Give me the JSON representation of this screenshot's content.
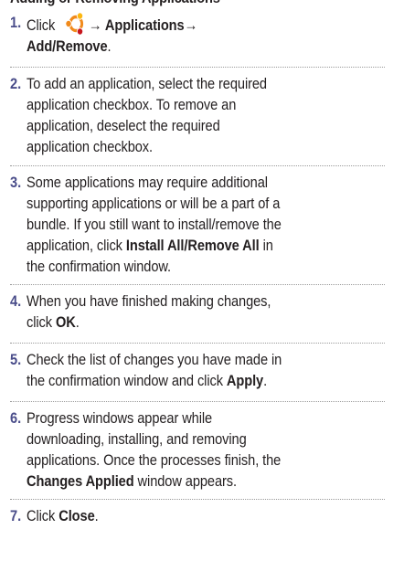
{
  "heading": "Adding or Removing Applications",
  "steps": [
    {
      "number": "1.",
      "segments": [
        {
          "text": "Click ",
          "bold": false
        },
        {
          "icon": "ubuntu-logo-icon"
        },
        {
          "text": "→ Applications→",
          "bold": true
        },
        {
          "br": true
        },
        {
          "text": "Add/Remove",
          "bold": true
        },
        {
          "text": ".",
          "bold": false
        }
      ]
    },
    {
      "number": "2.",
      "segments": [
        {
          "text": "To add an application, select the required",
          "bold": false
        },
        {
          "br": true
        },
        {
          "text": "application checkbox. To remove an",
          "bold": false
        },
        {
          "br": true
        },
        {
          "text": "application, deselect the required",
          "bold": false
        },
        {
          "br": true
        },
        {
          "text": "application checkbox.",
          "bold": false
        }
      ]
    },
    {
      "number": "3.",
      "segments": [
        {
          "text": "Some applications may require additional",
          "bold": false
        },
        {
          "br": true
        },
        {
          "text": "supporting applications or will be a part of a",
          "bold": false
        },
        {
          "br": true
        },
        {
          "text": "bundle. If you still want to install/remove the",
          "bold": false
        },
        {
          "br": true
        },
        {
          "text": "application, click ",
          "bold": false
        },
        {
          "text": "Install All/Remove All",
          "bold": true
        },
        {
          "text": " in",
          "bold": false
        },
        {
          "br": true
        },
        {
          "text": "the confirmation window.",
          "bold": false
        }
      ]
    },
    {
      "number": "4.",
      "segments": [
        {
          "text": "When you have finished making changes,",
          "bold": false
        },
        {
          "br": true
        },
        {
          "text": "click ",
          "bold": false
        },
        {
          "text": "OK",
          "bold": true
        },
        {
          "text": ".",
          "bold": false
        }
      ]
    },
    {
      "number": "5.",
      "segments": [
        {
          "text": "Check the list of changes you have made in",
          "bold": false
        },
        {
          "br": true
        },
        {
          "text": "the confirmation window and click ",
          "bold": false
        },
        {
          "text": "Apply",
          "bold": true
        },
        {
          "text": ".",
          "bold": false
        }
      ]
    },
    {
      "number": "6.",
      "segments": [
        {
          "text": "Progress windows appear while",
          "bold": false
        },
        {
          "br": true
        },
        {
          "text": "downloading, installing, and removing",
          "bold": false
        },
        {
          "br": true
        },
        {
          "text": "applications. Once the processes finish, the",
          "bold": false
        },
        {
          "br": true
        },
        {
          "text": "Changes Applied",
          "bold": true
        },
        {
          "text": " window appears.",
          "bold": false
        }
      ]
    },
    {
      "number": "7.",
      "segments": [
        {
          "text": "Click ",
          "bold": false
        },
        {
          "text": "Close",
          "bold": true
        },
        {
          "text": ".",
          "bold": false
        }
      ]
    }
  ],
  "colors": {
    "text": "#231f20",
    "step_number": "#4a4d8a",
    "logo_orange": "#f18a1b",
    "logo_red": "#c8161d",
    "logo_yellow": "#fcb711",
    "rule": "#9a9a9a"
  }
}
